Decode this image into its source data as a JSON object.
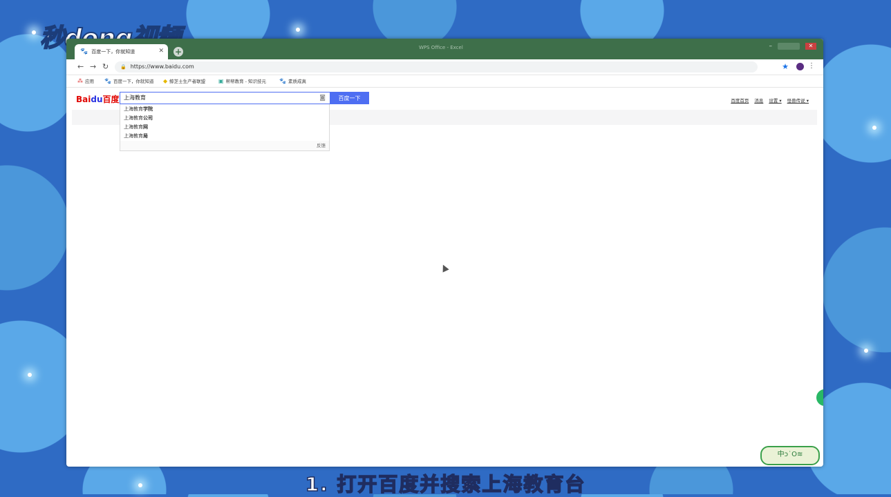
{
  "watermark": {
    "brand": "秒dong视频",
    "corner_badge": "中ↄ˙Ο≋"
  },
  "browser": {
    "tab_title": "百度一下，你就知道",
    "window_title": "WPS Office - Excel",
    "url": "https://www.baidu.com",
    "bookmarks": [
      {
        "label": "应用"
      },
      {
        "label": "百度一下，你就知道"
      },
      {
        "label": "鲸芝士生产者联盟"
      },
      {
        "label": "帮帮教育 - 知识技元"
      },
      {
        "label": "素质成真"
      }
    ]
  },
  "baidu": {
    "logo_red": "Bai",
    "logo_blue": "du",
    "logo_red2": "百度",
    "search_value": "上海教育",
    "search_button": "百度一下",
    "suggestions": [
      {
        "prefix": "上海教育",
        "suffix": "学院"
      },
      {
        "prefix": "上海教育",
        "suffix": "公司"
      },
      {
        "prefix": "上海教育",
        "suffix": "网"
      },
      {
        "prefix": "上海教育",
        "suffix": "局"
      }
    ],
    "feedback": "反馈",
    "top_links": [
      "百度首页",
      "消息",
      "设置 ▾",
      "怪兽传说 ▾"
    ]
  },
  "caption": "1.   打开百度并搜索上海教育台"
}
